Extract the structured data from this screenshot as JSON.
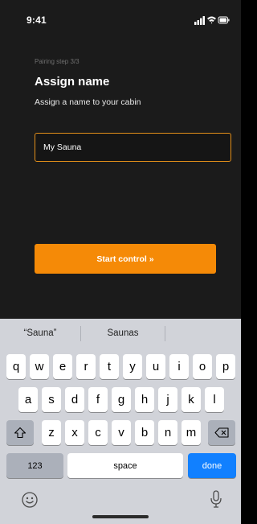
{
  "status_bar": {
    "time": "9:41"
  },
  "pairing": {
    "step_label": "Pairing step 3/3",
    "title": "Assign name",
    "subtitle": "Assign a name to your cabin",
    "name_value": "My Sauna",
    "start_button": "Start control »"
  },
  "colors": {
    "background": "#1b1b1b",
    "accent": "#f58a07",
    "keyboard_bg": "#d1d3d9",
    "done_key": "#1180ff"
  },
  "keyboard": {
    "suggestions": [
      "“Sauna”",
      "Saunas",
      ""
    ],
    "row1": [
      "q",
      "w",
      "e",
      "r",
      "t",
      "y",
      "u",
      "i",
      "o",
      "p"
    ],
    "row2": [
      "a",
      "s",
      "d",
      "f",
      "g",
      "h",
      "j",
      "k",
      "l"
    ],
    "row3": [
      "z",
      "x",
      "c",
      "v",
      "b",
      "n",
      "m"
    ],
    "shift_icon": "shift-icon",
    "backspace_icon": "backspace-icon",
    "numbers_label": "123",
    "space_label": "space",
    "done_label": "done",
    "emoji_icon": "emoji-icon",
    "mic_icon": "microphone-icon"
  }
}
